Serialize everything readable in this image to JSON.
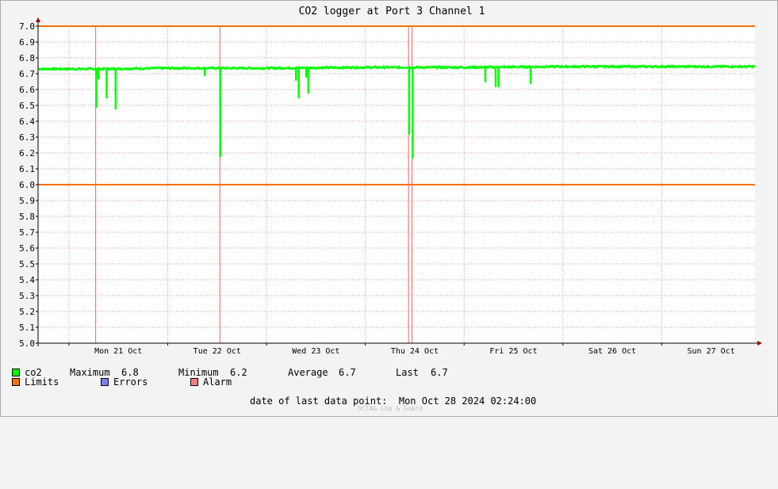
{
  "chart_data": {
    "type": "line",
    "title": "CO2 logger at Port 3 Channel 1",
    "xlabel": "",
    "ylabel": "",
    "x_range": [
      "2024-10-20T16:30",
      "2024-10-27T22:40"
    ],
    "ylim": [
      5.0,
      7.0
    ],
    "yticks": [
      5.0,
      5.1,
      5.2,
      5.3,
      5.4,
      5.5,
      5.6,
      5.7,
      5.8,
      5.9,
      6.0,
      6.1,
      6.2,
      6.3,
      6.4,
      6.5,
      6.6,
      6.7,
      6.8,
      6.9,
      7.0
    ],
    "ytick_labels": [
      "5.0",
      "5.1",
      "5.2",
      "5.3",
      "5.4",
      "5.5",
      "5.6",
      "5.7",
      "5.8",
      "5.9",
      "6.0",
      "6.1",
      "6.2",
      "6.3",
      "6.4",
      "6.5",
      "6.6",
      "6.7",
      "6.8",
      "6.9",
      "7.0"
    ],
    "xticks": [
      {
        "label": "Mon 21 Oct",
        "t": "2024-10-21T12:00"
      },
      {
        "label": "Tue 22 Oct",
        "t": "2024-10-22T12:00"
      },
      {
        "label": "Wed 23 Oct",
        "t": "2024-10-23T12:00"
      },
      {
        "label": "Thu 24 Oct",
        "t": "2024-10-24T12:00"
      },
      {
        "label": "Fri 25 Oct",
        "t": "2024-10-25T12:00"
      },
      {
        "label": "Sat 26 Oct",
        "t": "2024-10-26T12:00"
      },
      {
        "label": "Sun 27 Oct",
        "t": "2024-10-27T12:00"
      }
    ],
    "day_grid": [
      "2024-10-21T00:00",
      "2024-10-22T00:00",
      "2024-10-23T00:00",
      "2024-10-24T00:00",
      "2024-10-25T00:00",
      "2024-10-26T00:00",
      "2024-10-27T00:00"
    ],
    "grid": true,
    "limits": [
      6.0,
      7.0
    ],
    "alarm_times": [
      "2024-10-21T06:30",
      "2024-10-22T12:40",
      "2024-10-24T10:30",
      "2024-10-24T11:20"
    ],
    "series": [
      {
        "name": "co2",
        "color": "#00ff00",
        "baseline": [
          [
            "2024-10-20T16:30",
            6.73
          ],
          [
            "2024-10-21T08:00",
            6.73
          ],
          [
            "2024-10-22T00:00",
            6.735
          ],
          [
            "2024-10-23T00:00",
            6.735
          ],
          [
            "2024-10-24T00:00",
            6.74
          ],
          [
            "2024-10-25T00:00",
            6.74
          ],
          [
            "2024-10-26T00:00",
            6.745
          ],
          [
            "2024-10-27T00:00",
            6.745
          ],
          [
            "2024-10-27T22:40",
            6.745
          ]
        ],
        "dips": [
          [
            "2024-10-21T06:40",
            6.49
          ],
          [
            "2024-10-21T07:10",
            6.67
          ],
          [
            "2024-10-21T09:10",
            6.55
          ],
          [
            "2024-10-21T11:20",
            6.48
          ],
          [
            "2024-10-22T09:00",
            6.69
          ],
          [
            "2024-10-22T12:45",
            6.18
          ],
          [
            "2024-10-23T07:10",
            6.66
          ],
          [
            "2024-10-23T07:50",
            6.55
          ],
          [
            "2024-10-23T09:40",
            6.68
          ],
          [
            "2024-10-23T10:10",
            6.58
          ],
          [
            "2024-10-24T10:40",
            6.32
          ],
          [
            "2024-10-24T11:30",
            6.17
          ],
          [
            "2024-10-25T05:10",
            6.65
          ],
          [
            "2024-10-25T07:40",
            6.62
          ],
          [
            "2024-10-25T08:20",
            6.62
          ],
          [
            "2024-10-25T16:10",
            6.64
          ]
        ]
      }
    ]
  },
  "legend": {
    "co2": {
      "name": "co2",
      "color": "#00ff00",
      "max_label": "Maximum",
      "max_value": "6.8",
      "min_label": "Minimum",
      "min_value": "6.2",
      "avg_label": "Average",
      "avg_value": "6.7",
      "last_label": "Last",
      "last_value": "6.7"
    },
    "limits": {
      "name": "Limits",
      "color": "#ff7000"
    },
    "errors": {
      "name": "Errors",
      "color": "#7d7dff"
    },
    "alarm": {
      "name": "Alarm",
      "color": "#ff7d7d"
    }
  },
  "footer": {
    "label": "date of last data point:",
    "value": "Mon Oct 28 2024 02:24:00"
  },
  "watermark": "OCTA& Log & Guard",
  "colors": {
    "background": "#f3f3f3",
    "plot_background": "#ffffff",
    "grid": "#dd9999",
    "alarm_line": "#dd6666",
    "limit": "#ff7000",
    "axis_arrow": "#990000"
  }
}
